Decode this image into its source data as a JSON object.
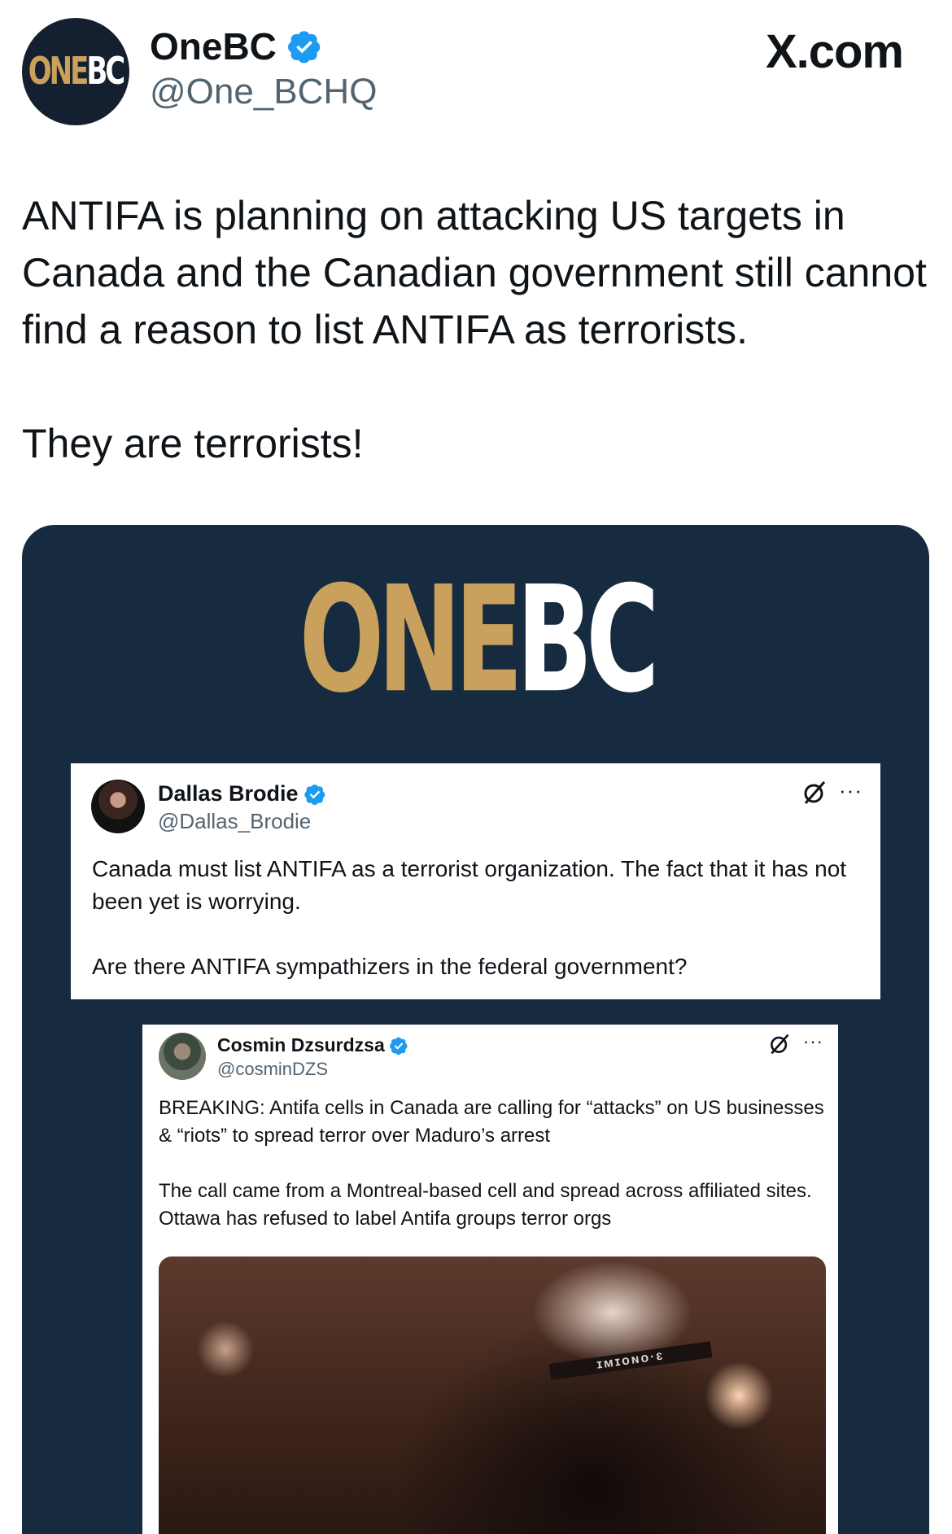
{
  "header": {
    "avatar_text_one": "ONE",
    "avatar_text_bc": "BC",
    "display_name": "OneBC",
    "handle": "@One_BCHQ",
    "site": "X.com"
  },
  "tweet": {
    "line1": "ANTIFA is planning on attacking US targets in Canada and the Canadian government still cannot find a reason to list ANTIFA as terrorists.",
    "line2": "They are terrorists!"
  },
  "media": {
    "brand_one": "ONE",
    "brand_bc": "BC",
    "quote1": {
      "name": "Dallas Brodie",
      "handle": "@Dallas_Brodie",
      "para1": "Canada must list ANTIFA as a terrorist organization. The fact that it has not been yet is worrying.",
      "para2": "Are there ANTIFA sympathizers in the federal government?",
      "more": "···"
    },
    "quote2": {
      "name": "Cosmin Dzsurdzsa",
      "handle": "@cosminDZS",
      "para1": "BREAKING: Antifa cells in Canada are calling for “attacks” on US businesses & “riots” to spread terror over Maduro’s arrest",
      "para2": "The call came from a Montreal-based cell and spread across affiliated sites. Ottawa has refused to label Antifa groups terror orgs",
      "more": "···",
      "photo_text": "ɪᴍɪᴏɴᴏ·ɛ"
    }
  },
  "colors": {
    "navy": "#162a40",
    "gold": "#c9a15d",
    "verified_blue": "#1d9bf0",
    "text": "#0f1419",
    "secondary": "#536471"
  }
}
